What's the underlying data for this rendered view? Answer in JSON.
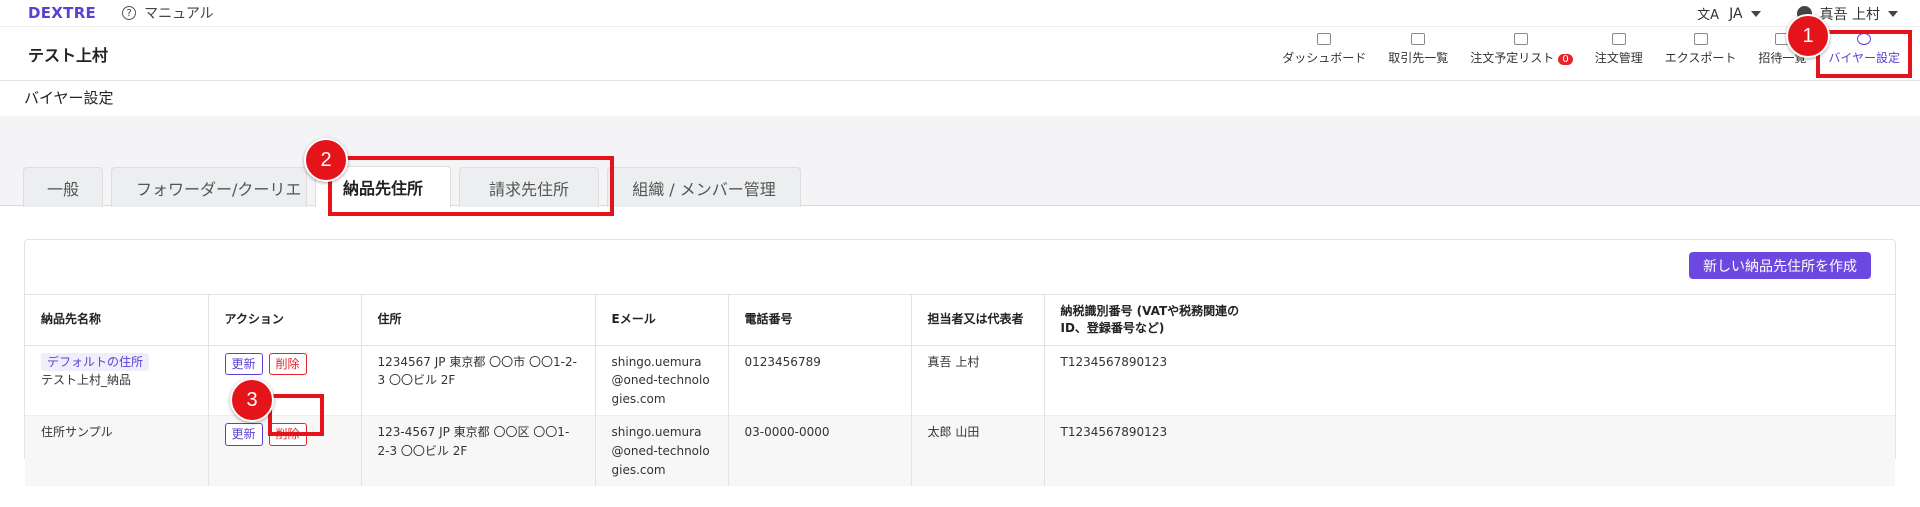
{
  "topbar": {
    "brand": "DEXTRE",
    "manual_label": "マニュアル",
    "language": "JA",
    "user_name": "真吾 上村"
  },
  "header": {
    "company": "テスト上村",
    "nav": [
      {
        "label": "ダッシュボード",
        "icon": "dashboard-icon"
      },
      {
        "label": "取引先一覧",
        "icon": "partners-icon"
      },
      {
        "label": "注文予定リスト",
        "icon": "order-plan-icon",
        "badge": "0"
      },
      {
        "label": "注文管理",
        "icon": "order-manage-icon"
      },
      {
        "label": "エクスポート",
        "icon": "export-icon"
      },
      {
        "label": "招待一覧",
        "icon": "invite-icon"
      },
      {
        "label": "バイヤー設定",
        "icon": "settings-icon",
        "active": true
      }
    ]
  },
  "page": {
    "title": "バイヤー設定"
  },
  "tabs": [
    {
      "label": "一般"
    },
    {
      "label": "フォワーダー/クーリエ"
    },
    {
      "label": "納品先住所",
      "active": true
    },
    {
      "label": "請求先住所"
    },
    {
      "label": "組織 / メンバー管理"
    }
  ],
  "card": {
    "create_button": "新しい納品先住所を作成",
    "columns": [
      "納品先名称",
      "アクション",
      "住所",
      "Eメール",
      "電話番号",
      "担当者又は代表者",
      "納税識別番号 (VATや税務関連のID、登録番号など)"
    ],
    "rows": [
      {
        "default_tag": "デフォルトの住所",
        "name": "テスト上村_納品",
        "update": "更新",
        "delete": "削除",
        "address": "1234567 JP 東京都 〇〇市 〇〇1-2-3 〇〇ビル 2F",
        "email": "shingo.uemura@oned-technologies.com",
        "phone": "0123456789",
        "contact": "真吾 上村",
        "tax_id": "T1234567890123"
      },
      {
        "name": "住所サンプル",
        "update": "更新",
        "delete": "削除",
        "address": "123-4567 JP 東京都 〇〇区 〇〇1-2-3 〇〇ビル 2F",
        "email": "shingo.uemura@oned-technologies.com",
        "phone": "03-0000-0000",
        "contact": "太郎 山田",
        "tax_id": "T1234567890123"
      }
    ]
  },
  "annotations": {
    "marker1": "1",
    "marker2": "2",
    "marker3": "3",
    "highlight_color": "#e5141b"
  }
}
